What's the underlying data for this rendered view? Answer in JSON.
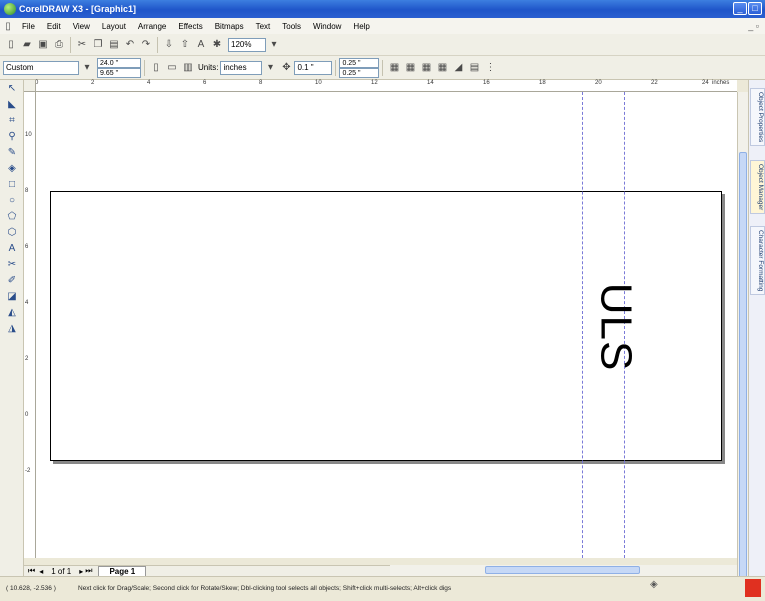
{
  "window": {
    "title": "CorelDRAW X3 - [Graphic1]",
    "min_glyph": "_",
    "max_glyph": "□",
    "close_glyph": "×"
  },
  "menu": [
    "File",
    "Edit",
    "View",
    "Layout",
    "Arrange",
    "Effects",
    "Bitmaps",
    "Text",
    "Tools",
    "Window",
    "Help"
  ],
  "toolbar": {
    "zoom_value": "120%"
  },
  "propertybar": {
    "paper_preset": "Custom",
    "page_width": "24.0 \"",
    "page_height": "9.65 \"",
    "units_label": "Units:",
    "units_value": "inches",
    "nudge_value": "0.1 \"",
    "dup_x": "0.25 \"",
    "dup_y": "0.25 \""
  },
  "ruler": {
    "top_labels": [
      "0",
      "2",
      "4",
      "6",
      "8",
      "10",
      "12",
      "14",
      "16",
      "18",
      "20",
      "22",
      "24"
    ],
    "unit_label": "inches",
    "left_labels": [
      "10",
      "8",
      "6",
      "4",
      "2",
      "0",
      "-2"
    ]
  },
  "canvas": {
    "rotated_text": "ULS"
  },
  "docker_tabs": [
    "Object Properties",
    "Object Manager",
    "Character Formatting"
  ],
  "pagenav": {
    "page_count": "1 of 1",
    "page_tab": "Page 1"
  },
  "status": {
    "coords": "( 10.628, -2.536 )",
    "hint": "Next click for Drag/Scale; Second click for Rotate/Skew; Dbl-clicking tool selects all objects; Shift+click multi-selects; Alt+click digs"
  },
  "colors": {
    "titlebar": "#1f55c9",
    "guide": "#7a7ad8",
    "scroll_thumb": "#c6d8f6"
  }
}
